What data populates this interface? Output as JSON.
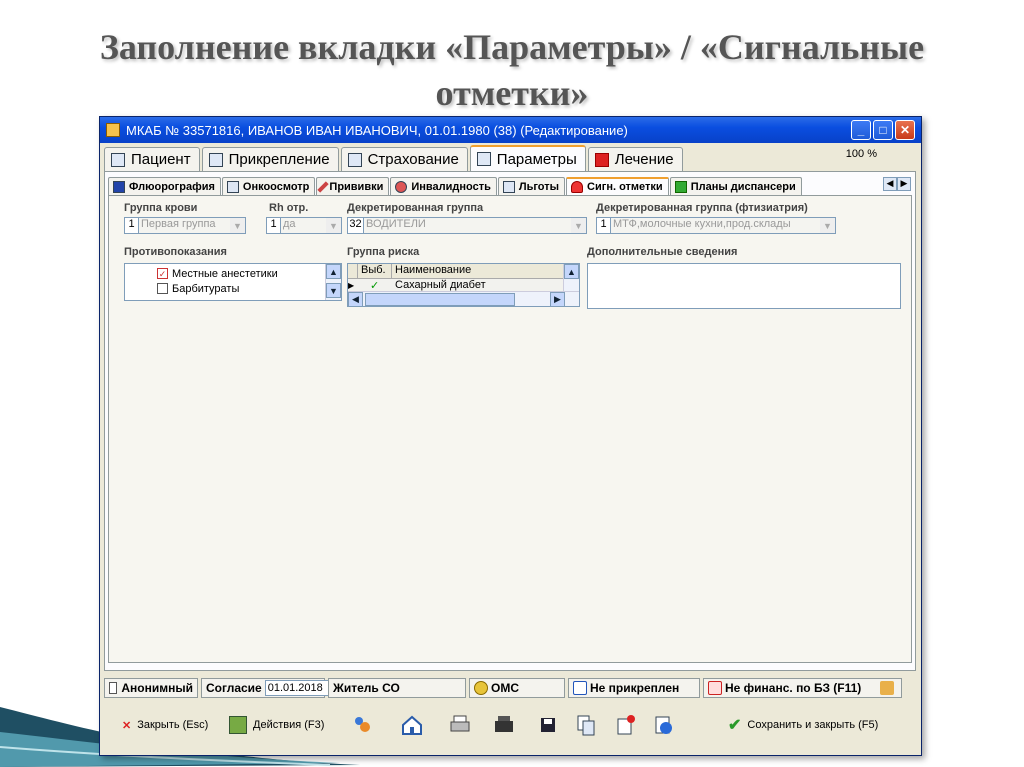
{
  "slide": {
    "title_line1": "Заполнение вкладки «Параметры» / «Сигнальные",
    "title_line2": "отметки»"
  },
  "window": {
    "title": "МКАБ № 33571816, ИВАНОВ ИВАН ИВАНОВИЧ,  01.01.1980 (38) (Редактирование)",
    "minimize": "_",
    "maximize": "□",
    "close": "✕",
    "zoom": "100 %"
  },
  "main_tabs": [
    {
      "label": "Пациент"
    },
    {
      "label": "Прикрепление"
    },
    {
      "label": "Страхование"
    },
    {
      "label": "Параметры"
    },
    {
      "label": "Лечение"
    }
  ],
  "sub_tabs": [
    {
      "label": "Флюорография"
    },
    {
      "label": "Онкоосмотр"
    },
    {
      "label": "Прививки"
    },
    {
      "label": "Инвалидность"
    },
    {
      "label": "Льготы"
    },
    {
      "label": "Сигн. отметки"
    },
    {
      "label": "Планы диспансери"
    }
  ],
  "form": {
    "blood_group": {
      "label": "Группа крови",
      "code": "1",
      "value": "Первая группа"
    },
    "rh": {
      "label": "Rh отр.",
      "code": "1",
      "value": "да"
    },
    "decreed_group": {
      "label": "Декретированная группа",
      "code": "32",
      "value": "ВОДИТЕЛИ"
    },
    "decreed_group_ftiz": {
      "label": "Декретированная группа (фтизиатрия)",
      "code": "1",
      "value": "МТФ,молочные кухни,прод.склады"
    },
    "contraindications": {
      "label": "Противопоказания",
      "items": [
        "Местные анестетики",
        "Барбитураты"
      ]
    },
    "risk_group": {
      "label": "Группа риска",
      "col_select": "Выб.",
      "col_name": "Наименование",
      "row_value": "Сахарный диабет"
    },
    "additional_info": {
      "label": "Дополнительные сведения"
    }
  },
  "statusbar": {
    "anonymous": "Анонимный",
    "consent_label": "Согласие",
    "consent_date": "01.01.2018",
    "resident": "Житель СО",
    "oms": "ОМС",
    "not_attached": "Не прикреплен",
    "not_financed": "Не финанс. по БЗ (F11)"
  },
  "toolbar": {
    "close_label": "Закрыть (Esc)",
    "actions_label": "Действия (F3)",
    "save_close_label": "Сохранить и закрыть (F5)"
  }
}
